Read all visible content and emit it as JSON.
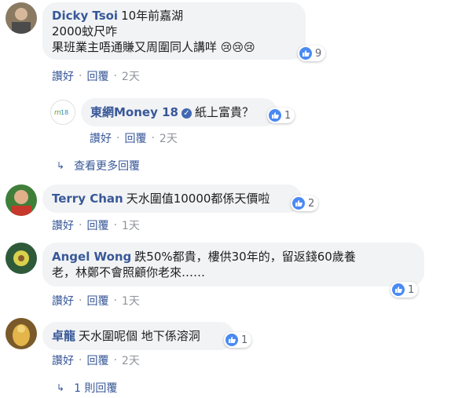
{
  "comments": [
    {
      "author": "Dicky Tsoi",
      "lines": [
        "10年前嘉湖",
        "2000蚊尺咋",
        "果班業主唔通賺又周圍同人講咩"
      ],
      "emoji": [
        "😢",
        "😢",
        "😢"
      ],
      "reaction_count": "9",
      "like_label": "讚好",
      "reply_label": "回覆",
      "time": "2天"
    },
    {
      "author": "東網Money 18",
      "verified": true,
      "text": "紙上富貴？",
      "reaction_count": "1",
      "like_label": "讚好",
      "reply_label": "回覆",
      "time": "2天"
    },
    {
      "author": "Terry Chan",
      "text": "天水圍值10000都係天價啦",
      "reaction_count": "2",
      "like_label": "讚好",
      "reply_label": "回覆",
      "time": "1天"
    },
    {
      "author": "Angel Wong",
      "lines": [
        "跌50%都貴，樓供30年的，留返錢60歲養",
        "老，林鄭不會照顧你老來……"
      ],
      "reaction_count": "1",
      "like_label": "讚好",
      "reply_label": "回覆",
      "time": "1天"
    },
    {
      "author": "卓龍",
      "text": "天水圍呢個 地下係溶洞",
      "reaction_count": "1",
      "like_label": "讚好",
      "reply_label": "回覆",
      "time": "2天"
    }
  ],
  "view_more_replies": "查看更多回覆",
  "one_reply": "1 則回覆",
  "colors": {
    "link": "#385898",
    "bubble": "#f2f3f5",
    "like": "#4a8af4",
    "meta": "#90949c"
  },
  "icons": {
    "like": "thumbs-up-icon",
    "reply_arrow": "reply-arrow-icon",
    "verified": "verified-check-icon"
  }
}
